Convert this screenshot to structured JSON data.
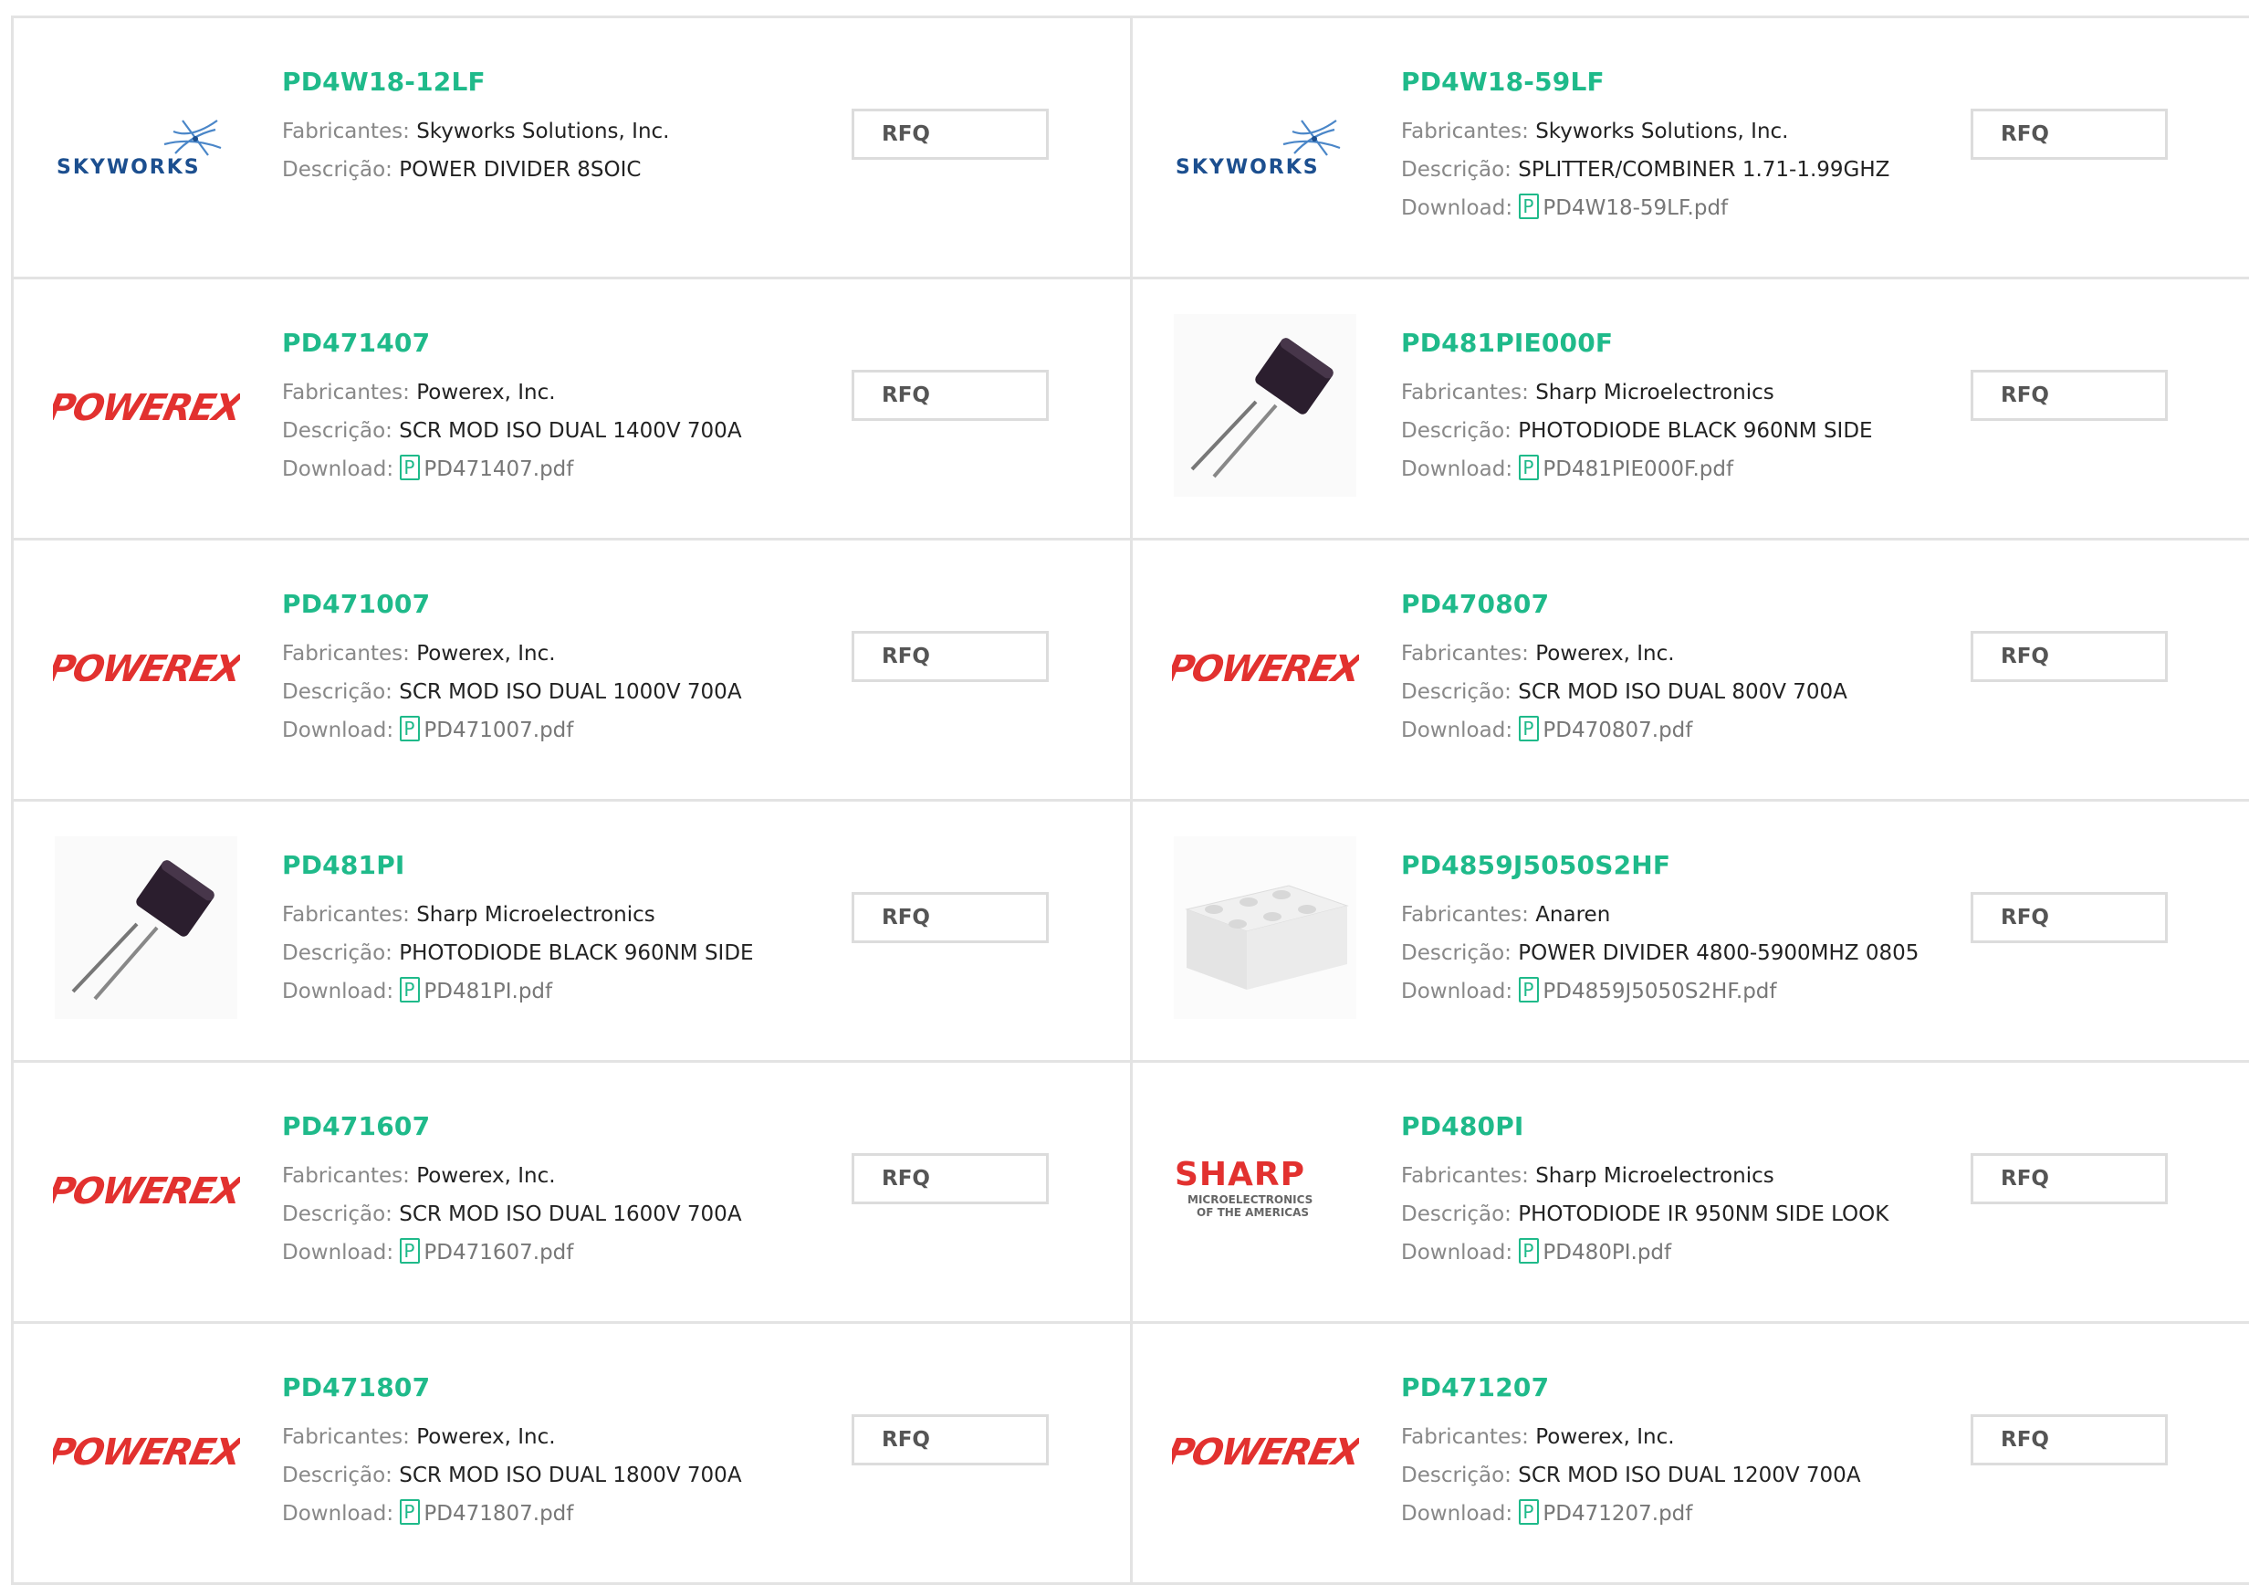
{
  "labels": {
    "manufacturer": "Fabricantes:",
    "description": "Descrição:",
    "download": "Download:",
    "rfq": "RFQ"
  },
  "colors": {
    "accent": "#1fba8a",
    "border": "#e3e3e3",
    "powerex_red": "#e2312f",
    "skyworks_blue": "#1c4f8f",
    "sharp_red": "#e2312f"
  },
  "brands": {
    "skyworks": "SKYWORKS",
    "powerex": "POWEREX",
    "sharp": "SHARP",
    "sharp_sub1": "MICROELECTRONICS",
    "sharp_sub2": "OF THE AMERICAS"
  },
  "products": [
    {
      "pn": "PD4W18-12LF",
      "logo": "skyworks-logo",
      "manufacturer": "Skyworks Solutions, Inc.",
      "description": "POWER DIVIDER 8SOIC"
    },
    {
      "pn": "PD4W18-59LF",
      "logo": "skyworks-logo",
      "manufacturer": "Skyworks Solutions, Inc.",
      "description": "SPLITTER/COMBINER 1.71-1.99GHZ",
      "file": "PD4W18-59LF.pdf"
    },
    {
      "pn": "PD471407",
      "logo": "powerex-logo",
      "manufacturer": "Powerex, Inc.",
      "description": "SCR MOD ISO DUAL 1400V 700A",
      "file": "PD471407.pdf"
    },
    {
      "pn": "PD481PIE000F",
      "logo": "photodiode-image",
      "manufacturer": "Sharp Microelectronics",
      "description": "PHOTODIODE BLACK 960NM SIDE",
      "file": "PD481PIE000F.pdf"
    },
    {
      "pn": "PD471007",
      "logo": "powerex-logo",
      "manufacturer": "Powerex, Inc.",
      "description": "SCR MOD ISO DUAL 1000V 700A",
      "file": "PD471007.pdf"
    },
    {
      "pn": "PD470807",
      "logo": "powerex-logo",
      "manufacturer": "Powerex, Inc.",
      "description": "SCR MOD ISO DUAL 800V 700A",
      "file": "PD470807.pdf"
    },
    {
      "pn": "PD481PI",
      "logo": "photodiode-image",
      "manufacturer": "Sharp Microelectronics",
      "description": "PHOTODIODE BLACK 960NM SIDE",
      "file": "PD481PI.pdf"
    },
    {
      "pn": "PD4859J5050S2HF",
      "logo": "chip-image",
      "manufacturer": "Anaren",
      "description": "POWER DIVIDER 4800-5900MHZ 0805",
      "file": "PD4859J5050S2HF.pdf"
    },
    {
      "pn": "PD471607",
      "logo": "powerex-logo",
      "manufacturer": "Powerex, Inc.",
      "description": "SCR MOD ISO DUAL 1600V 700A",
      "file": "PD471607.pdf"
    },
    {
      "pn": "PD480PI",
      "logo": "sharp-logo",
      "manufacturer": "Sharp Microelectronics",
      "description": "PHOTODIODE IR 950NM SIDE LOOK",
      "file": "PD480PI.pdf"
    },
    {
      "pn": "PD471807",
      "logo": "powerex-logo",
      "manufacturer": "Powerex, Inc.",
      "description": "SCR MOD ISO DUAL 1800V 700A",
      "file": "PD471807.pdf"
    },
    {
      "pn": "PD471207",
      "logo": "powerex-logo",
      "manufacturer": "Powerex, Inc.",
      "description": "SCR MOD ISO DUAL 1200V 700A",
      "file": "PD471207.pdf"
    }
  ]
}
